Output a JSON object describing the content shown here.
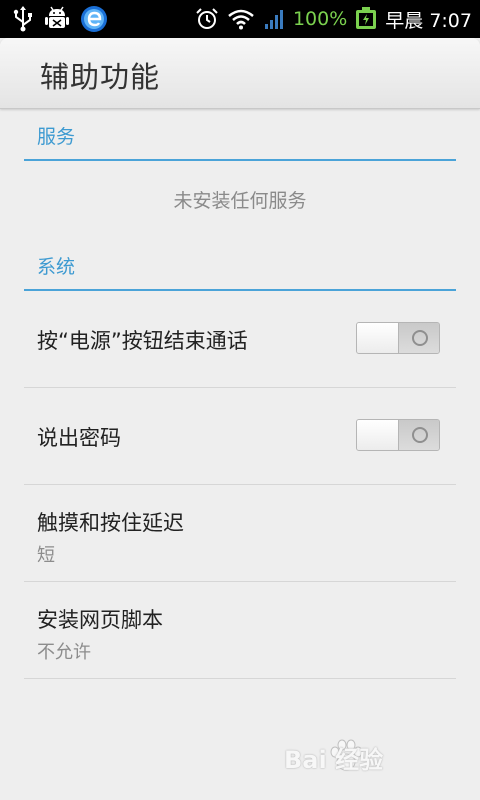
{
  "status_bar": {
    "icons_left": [
      "usb-icon",
      "android-debug-icon",
      "browser-app-icon"
    ],
    "icons_right": [
      "alarm-icon",
      "wifi-icon",
      "signal-icon",
      "battery-icon"
    ],
    "battery_percent": "100%",
    "time": "早晨 7:07",
    "colors": {
      "background": "#000000",
      "battery_text": "#7bd14f"
    }
  },
  "header": {
    "title": "辅助功能"
  },
  "sections": {
    "services": {
      "title": "服务",
      "empty_text": "未安装任何服务"
    },
    "system": {
      "title": "系统",
      "items": [
        {
          "title": "按“电源”按钮结束通话",
          "toggle_state": "off"
        },
        {
          "title": "说出密码",
          "toggle_state": "off"
        },
        {
          "title": "触摸和按住延迟",
          "summary": "短"
        },
        {
          "title": "安装网页脚本",
          "summary": "不允许"
        }
      ]
    }
  },
  "watermark": {
    "text": "Bai 经验",
    "logo": "baidu-paw-logo"
  },
  "colors": {
    "accent": "#3d9ad1",
    "divider": "#4aa3d8",
    "background": "#eeeeee"
  }
}
